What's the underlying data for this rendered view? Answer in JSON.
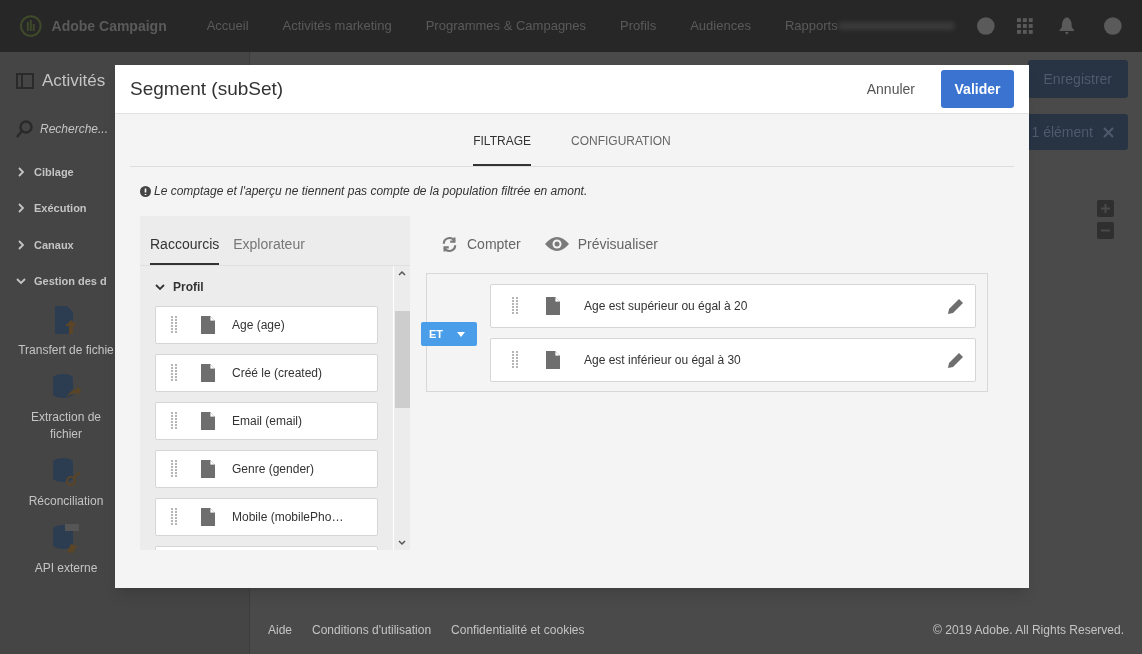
{
  "topbar": {
    "brand": "Adobe Campaign",
    "nav": [
      "Accueil",
      "Activités marketing",
      "Programmes & Campagnes",
      "Profils",
      "Audiences",
      "Rapports"
    ]
  },
  "sidebar": {
    "title": "Activités",
    "search": {
      "placeholder": "Recherche..."
    },
    "categories": [
      {
        "label": "Ciblage",
        "expanded": false
      },
      {
        "label": "Exécution",
        "expanded": false
      },
      {
        "label": "Canaux",
        "expanded": false
      },
      {
        "label": "Gestion des d",
        "expanded": true
      }
    ],
    "activities": [
      {
        "kind": "file",
        "label": "Transfert de fichie"
      },
      {
        "kind": "extract",
        "label": "Extraction de fichier"
      },
      {
        "kind": "reconcile",
        "label": "Réconciliation"
      },
      {
        "kind": "api",
        "label": "API externe"
      }
    ]
  },
  "canvas": {
    "save_button": "Enregistrer",
    "selection_chip": "1 élément"
  },
  "footer": {
    "links": [
      "Aide",
      "Conditions d'utilisation",
      "Confidentialité et cookies"
    ],
    "copyright": "© 2019 Adobe. All Rights Reserved."
  },
  "dialog": {
    "title": "Segment (subSet)",
    "cancel": "Annuler",
    "confirm": "Valider",
    "tabs": [
      {
        "label": "FILTRAGE",
        "selected": true
      },
      {
        "label": "CONFIGURATION",
        "selected": false
      }
    ],
    "notice": "Le comptage et l'aperçu ne tiennent pas compte de la population filtrée en amont.",
    "palette": {
      "tabs": [
        {
          "label": "Raccourcis",
          "selected": true
        },
        {
          "label": "Explorateur",
          "selected": false
        }
      ],
      "groups": [
        {
          "label": "Profil",
          "expanded": true,
          "fields": [
            "Age (age)",
            "Créé le (created)",
            "Email (email)",
            "Genre (gender)",
            "Mobile (mobilePho…"
          ]
        }
      ]
    },
    "actions": [
      {
        "kind": "count",
        "label": "Compter"
      },
      {
        "kind": "preview",
        "label": "Prévisualiser"
      }
    ],
    "rule": {
      "operator": "ET",
      "conditions": [
        "Age est supérieur ou égal à 20",
        "Age est inférieur ou égal à 30"
      ]
    }
  }
}
